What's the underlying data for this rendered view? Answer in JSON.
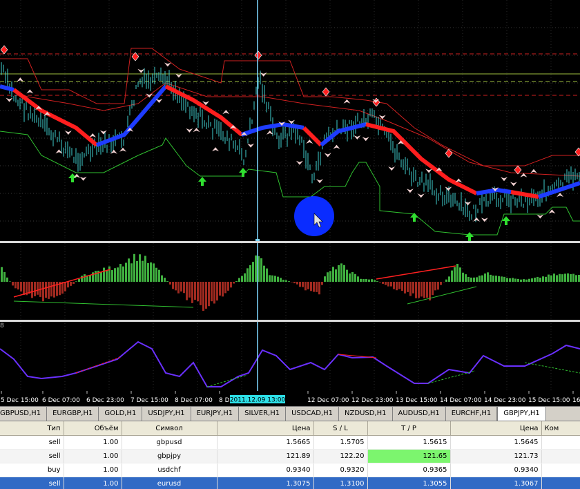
{
  "chart": {
    "price_levels": [
      {
        "role": "resistance",
        "color": "#d02020",
        "style": "dashed"
      },
      {
        "role": "pivot",
        "color": "#a0c040",
        "style": "solid"
      },
      {
        "role": "support",
        "color": "#a0c040",
        "style": "dashed"
      }
    ],
    "time_axis": [
      "5 Dec 15:00",
      "6 Dec 07:00",
      "6 Dec 23:00",
      "7 Dec 15:00",
      "8 Dec 07:00",
      "8 D",
      "12 Dec 07:00",
      "12 Dec 23:00",
      "13 Dec 15:00",
      "14 Dec 07:00",
      "14 Dec 23:00",
      "15 Dec 15:00",
      "16"
    ],
    "crosshair_label": "2011.12.09 13:00",
    "sub_pane_label": "8",
    "colors": {
      "bull": "#1e3cff",
      "bear": "#ff1e1e",
      "price": "#3fd0d0",
      "envelope_up": "#d02020",
      "envelope_dn": "#30c030",
      "hist_up": "#40b040",
      "hist_dn": "#a02a20",
      "osc_line": "#6a30ff",
      "crosshair": "#7fd8ff",
      "cursor_ring": "#0a2cff"
    }
  },
  "symbol_tabs": [
    {
      "label": "GBPUSD,H1"
    },
    {
      "label": "EURGBP,H1"
    },
    {
      "label": "GOLD,H1"
    },
    {
      "label": "USDJPY,H1"
    },
    {
      "label": "EURJPY,H1"
    },
    {
      "label": "SILVER,H1"
    },
    {
      "label": "USDCAD,H1"
    },
    {
      "label": "NZDUSD,H1"
    },
    {
      "label": "AUDUSD,H1"
    },
    {
      "label": "EURCHF,H1"
    },
    {
      "label": "GBPJPY,H1",
      "active": true
    }
  ],
  "orders": {
    "columns": [
      "Тип",
      "Объём",
      "Символ",
      "Цена",
      "S / L",
      "T / P",
      "Цена",
      "Ком"
    ],
    "rows": [
      {
        "type": "sell",
        "volume": "1.00",
        "symbol": "gbpusd",
        "price": "1.5665",
        "sl": "1.5705",
        "tp": "1.5615",
        "current": "1.5645",
        "comment": ""
      },
      {
        "type": "sell",
        "volume": "1.00",
        "symbol": "gbpjpy",
        "price": "121.89",
        "sl": "122.20",
        "tp": "121.65",
        "current": "121.73",
        "comment": ""
      },
      {
        "type": "buy",
        "volume": "1.00",
        "symbol": "usdchf",
        "price": "0.9340",
        "sl": "0.9320",
        "tp": "0.9365",
        "current": "0.9340",
        "comment": ""
      },
      {
        "type": "sell",
        "volume": "1.00",
        "symbol": "eurusd",
        "price": "1.3075",
        "sl": "1.3100",
        "tp": "1.3055",
        "current": "1.3067",
        "comment": ""
      }
    ],
    "highlight_tp_row": 1,
    "selected_row": 3
  }
}
